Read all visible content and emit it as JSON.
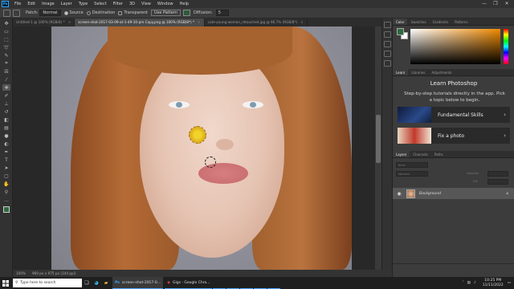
{
  "menubar": {
    "logo": "Ps",
    "items": [
      "File",
      "Edit",
      "Image",
      "Layer",
      "Type",
      "Select",
      "Filter",
      "3D",
      "View",
      "Window",
      "Help"
    ],
    "window_controls": [
      "—",
      "❐",
      "✕"
    ]
  },
  "options": {
    "patch_label": "Patch:",
    "patch_mode": "Normal",
    "source_label": "Source",
    "destination_label": "Destination",
    "transparent_label": "Transparent",
    "use_pattern_label": "Use Pattern",
    "diffusion_label": "Diffusion:",
    "diffusion_value": "5",
    "pattern_color": "#2c5a3a"
  },
  "tabs": [
    {
      "label": "Untitled-1 @ 100% (RGB/8) *",
      "active": false
    },
    {
      "label": "screen-shot-2017-03-09-at-1-49-10-pm Copy.png @ 100% (RGB/8*) *",
      "active": true
    },
    {
      "label": "cute-young-woman_retouched.jpg @ 66.7% (RGB/8*)",
      "active": false
    }
  ],
  "tools": [
    "move",
    "artboard",
    "marquee",
    "lasso",
    "quick-select",
    "crop",
    "frame",
    "eyedropper",
    "spot-heal",
    "brush",
    "stamp",
    "history-brush",
    "eraser",
    "gradient",
    "blur",
    "dodge",
    "pen",
    "type",
    "path-select",
    "shape",
    "hand",
    "zoom",
    "more",
    "fg-bg"
  ],
  "status": {
    "zoom": "100%",
    "doc_size": "960 px x 975 px (144 ppi)"
  },
  "color_panel": {
    "tabs": [
      "Color",
      "Swatches",
      "Gradients",
      "Patterns"
    ],
    "foreground": "#2e6b3f",
    "background": "#ffffff",
    "field_hue": "#f08a00"
  },
  "learn_panel": {
    "tabs": [
      "Learn",
      "Libraries",
      "Adjustments"
    ],
    "title": "Learn Photoshop",
    "subtitle": "Step-by-step tutorials directly in the app. Pick a topic below to begin.",
    "cards": [
      "Fundamental Skills",
      "Fix a photo"
    ]
  },
  "layers_panel": {
    "tabs": [
      "Layers",
      "Channels",
      "Paths"
    ],
    "kind_label": "Kind",
    "blend_mode": "Normal",
    "opacity_label": "Opacity:",
    "fill_label": "Fill:",
    "layer_name": "Background"
  },
  "taskbar": {
    "search_placeholder": "Type here to search",
    "apps": [
      {
        "label": "screen-shot-2017-0...",
        "active": true
      },
      {
        "label": "Gigs - Google Chro...",
        "active": false
      }
    ],
    "time": "10:25 PM",
    "date": "11/11/2022"
  }
}
